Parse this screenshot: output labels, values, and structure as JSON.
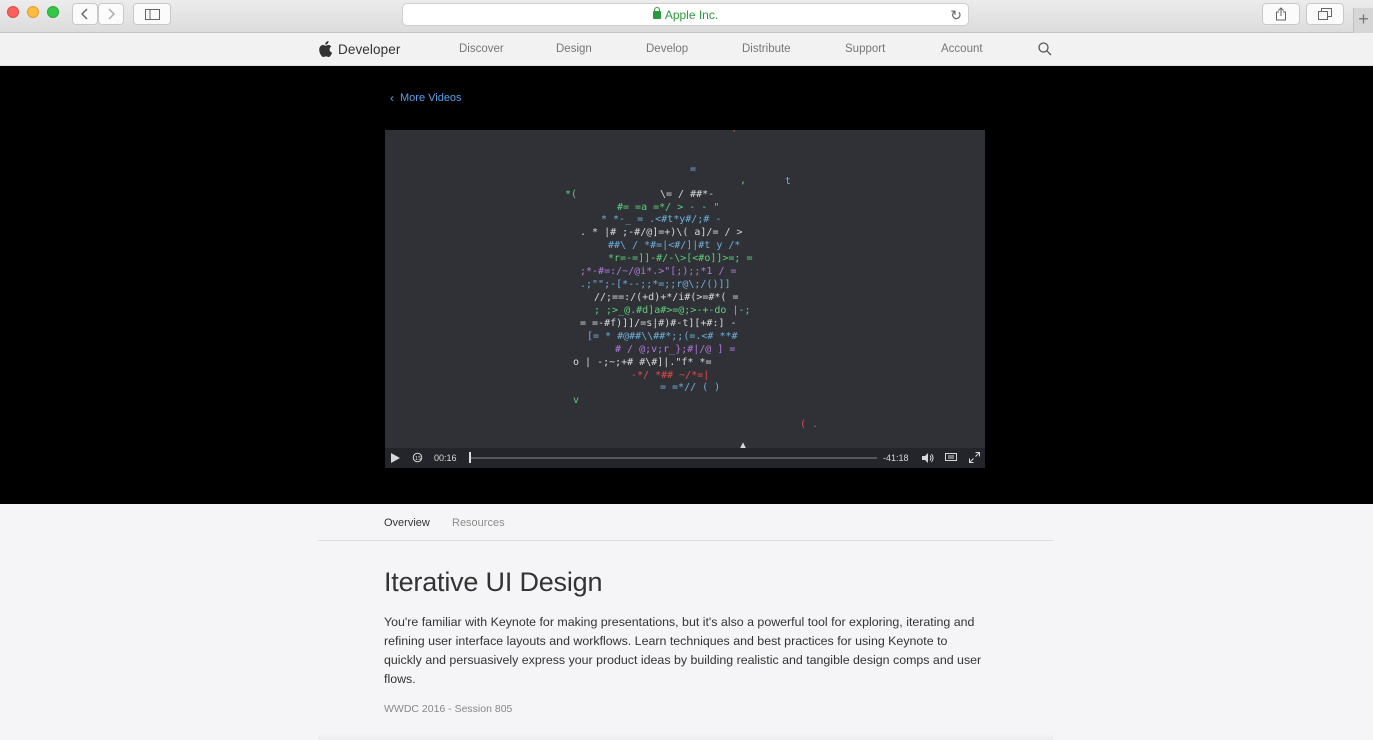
{
  "browser": {
    "address": "Apple Inc.",
    "icons": [
      "back-icon",
      "forward-icon",
      "sidebar-icon",
      "lock-icon",
      "reload-icon",
      "share-icon",
      "tabs-icon",
      "new-tab-icon"
    ]
  },
  "sitenav": {
    "brand": "Developer",
    "links": [
      "Discover",
      "Design",
      "Develop",
      "Distribute",
      "Support",
      "Account"
    ]
  },
  "video": {
    "back_link": "More Videos",
    "elapsed": "00:16",
    "remaining": "-41:18"
  },
  "tabs": {
    "overview": "Overview",
    "resources": "Resources"
  },
  "session": {
    "title": "Iterative UI Design",
    "description": "You're familiar with Keynote for making presentations, but it's also a powerful tool for exploring, iterating and refining user interface layouts and workflows. Learn techniques and best practices for using Keynote to quickly and persuasively express your product ideas by building realistic and tangible design comps and user flows.",
    "meta": "WWDC 2016 - Session 805"
  },
  "colors": {
    "link": "#5b9fe8",
    "secure": "#2a9b3c",
    "video_bg": "#2f3137"
  }
}
